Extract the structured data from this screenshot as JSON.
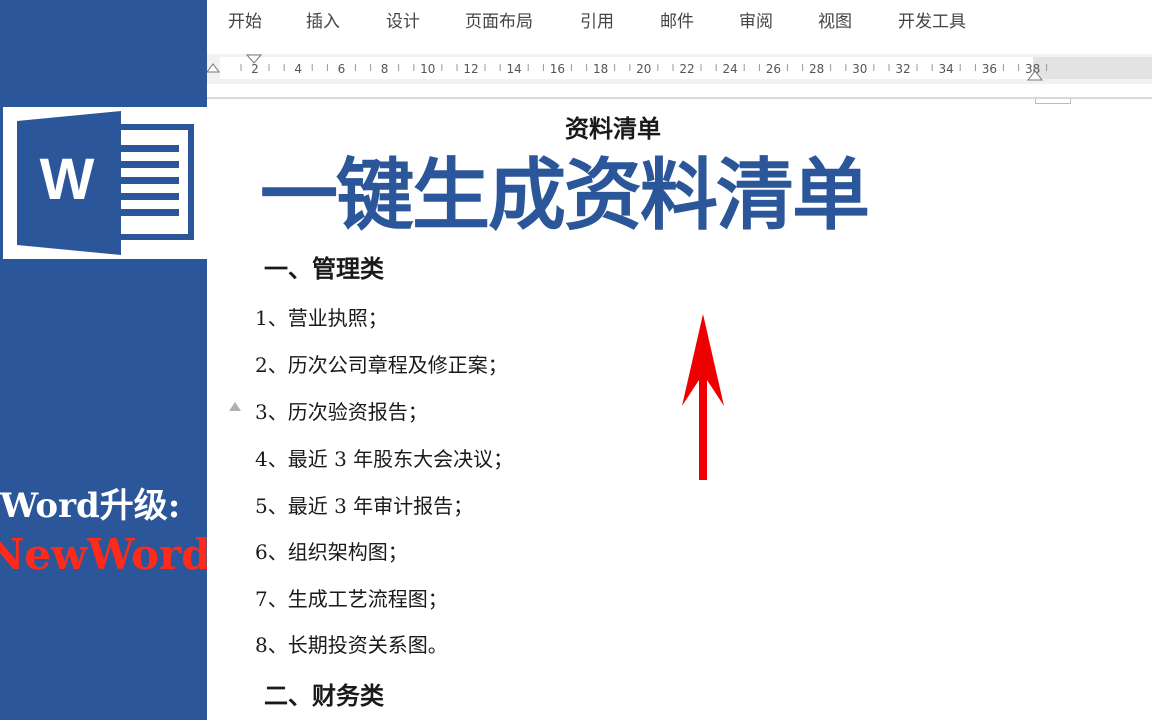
{
  "ribbon": {
    "tabs": [
      "开始",
      "插入",
      "设计",
      "页面布局",
      "引用",
      "邮件",
      "审阅",
      "视图",
      "开发工具"
    ]
  },
  "ruler": {
    "ticks": [
      "2",
      "4",
      "6",
      "8",
      "10",
      "12",
      "14",
      "16",
      "18",
      "20",
      "22",
      "24",
      "26",
      "28",
      "30",
      "32",
      "34",
      "36",
      "38"
    ]
  },
  "brand": {
    "logo_letter": "W",
    "line1": "Word升级:",
    "line2": "NewWord",
    "panel_color": "#2b579a",
    "accent_color": "#ff2a1a"
  },
  "overlay": {
    "title": "一键生成资料清单",
    "color": "#2b579a"
  },
  "document": {
    "title": "资料清单",
    "section1": "一、管理类",
    "items": [
      "1、营业执照；",
      "2、历次公司章程及修正案；",
      "3、历次验资报告；",
      "4、最近 3 年股东大会决议；",
      "5、最近 3 年审计报告；",
      "6、组织架构图；",
      "7、生成工艺流程图；",
      "8、长期投资关系图。"
    ],
    "section2": "二、财务类"
  },
  "icons": {
    "arrow": "red-up-arrow-icon",
    "logo": "word-logo-icon",
    "collapse": "collapse-triangle-icon"
  }
}
